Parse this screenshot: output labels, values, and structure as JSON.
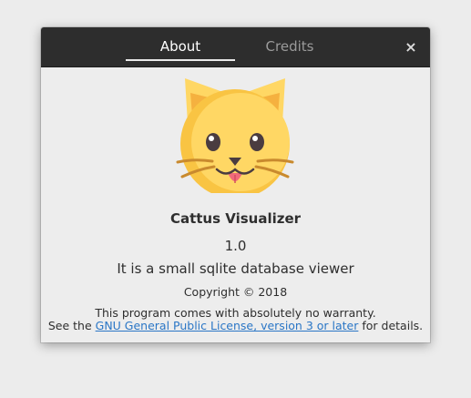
{
  "tabs": [
    {
      "label": "About",
      "active": true
    },
    {
      "label": "Credits",
      "active": false
    }
  ],
  "close_glyph": "×",
  "logo": {
    "icon": "cat-face-icon"
  },
  "app": {
    "name": "Cattus Visualizer",
    "version": "1.0",
    "comments": "It is a small sqlite database viewer",
    "copyright": "Copyright © 2018"
  },
  "license": {
    "line1": "This program comes with absolutely no warranty.",
    "prefix": "See the",
    "link_text": "GNU General Public License, version 3 or later",
    "suffix": "for details."
  },
  "colors": {
    "titlebar": "#2d2d2d",
    "background": "#ededed",
    "link": "#2a76c6",
    "cat_face": "#ffd764",
    "cat_ear_inner": "#f5b13f"
  }
}
